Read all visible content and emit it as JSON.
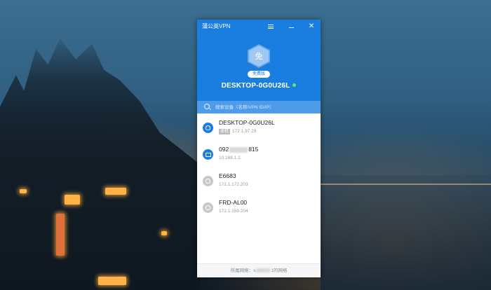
{
  "app": {
    "title": "蒲公英VPN",
    "logo_char": "免",
    "edition_badge": "免费版",
    "device_name": "DESKTOP-0G0U26L",
    "accent_color": "#1a7de0",
    "online_dot_color": "#6fe06f"
  },
  "search": {
    "placeholder": "搜索设备（名称/VPN ID/IP）"
  },
  "devices": [
    {
      "name": "DESKTOP-0G0U26L",
      "tag": "本机",
      "ip": "172.1.97.29",
      "icon": "user-icon",
      "status": "online"
    },
    {
      "name_prefix": "092",
      "name_suffix": "815",
      "ip": "10.168.1.1",
      "icon": "computer-icon",
      "status": "online"
    },
    {
      "name": "E6683",
      "ip": "172.1.172.203",
      "icon": "user-icon",
      "status": "offline"
    },
    {
      "name": "FRD-AL00",
      "ip": "172.1.159.204",
      "icon": "user-icon",
      "status": "offline"
    }
  ],
  "footer": {
    "prefix": "所属网络：s",
    "suffix": "1的网络"
  }
}
